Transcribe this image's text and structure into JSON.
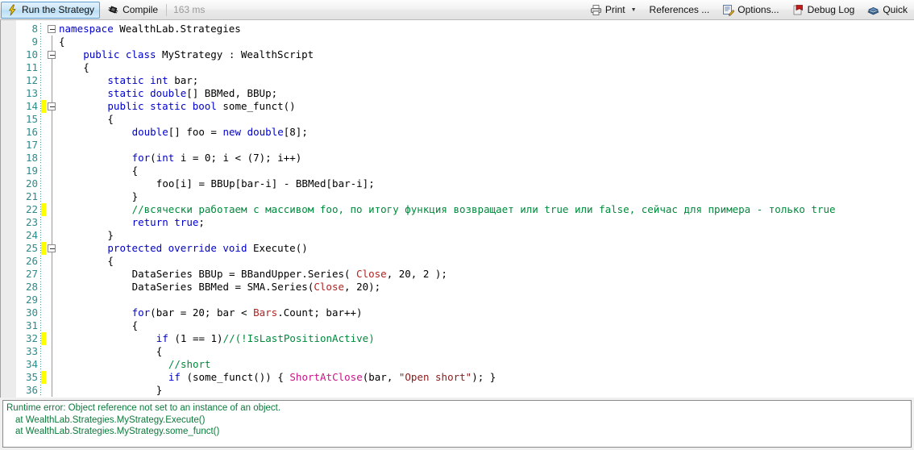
{
  "toolbar": {
    "run_label": "Run the Strategy",
    "compile_label": "Compile",
    "compile_time": "163 ms",
    "print_label": "Print",
    "references_label": "References ...",
    "options_label": "Options...",
    "debug_log_label": "Debug Log",
    "quick_label": "Quick",
    "icons": {
      "run": "lightning-bolt-icon",
      "compile": "chip-icon",
      "print": "printer-icon",
      "options": "pencil-note-icon",
      "debug": "bookmark-flag-icon",
      "quick": "book-icon"
    },
    "colors": {
      "active_button_border": "#5b9fd4",
      "active_button_fill": "#c9e6f8",
      "time_text": "#9a9a9a"
    }
  },
  "editor": {
    "first_line_number": 8,
    "gutter_color": "#2e8b8b",
    "modified_marker_color": "#ffff00",
    "syntax_colors": {
      "keyword": "#0000cd",
      "comment": "#008a3c",
      "type": "#b22222",
      "string": "#8b1a1a",
      "function": "#c71585",
      "plain": "#000000"
    },
    "lines": [
      {
        "n": 8,
        "marked": false,
        "fold": "open",
        "guide": false,
        "indent": 0,
        "tokens": [
          {
            "t": "namespace ",
            "c": "kw"
          },
          {
            "t": "WealthLab.Strategies",
            "c": "pl"
          }
        ]
      },
      {
        "n": 9,
        "marked": false,
        "fold": "none",
        "guide": true,
        "indent": 0,
        "tokens": [
          {
            "t": "{",
            "c": "pl"
          }
        ]
      },
      {
        "n": 10,
        "marked": false,
        "fold": "open",
        "guide": true,
        "indent": 2,
        "tokens": [
          {
            "t": "public class ",
            "c": "kw"
          },
          {
            "t": "MyStrategy : WealthScript",
            "c": "pl"
          }
        ]
      },
      {
        "n": 11,
        "marked": false,
        "fold": "none",
        "guide": true,
        "indent": 2,
        "tokens": [
          {
            "t": "{",
            "c": "pl"
          }
        ]
      },
      {
        "n": 12,
        "marked": false,
        "fold": "none",
        "guide": true,
        "indent": 4,
        "tokens": [
          {
            "t": "static int ",
            "c": "kw"
          },
          {
            "t": "bar;",
            "c": "pl"
          }
        ]
      },
      {
        "n": 13,
        "marked": false,
        "fold": "none",
        "guide": true,
        "indent": 4,
        "tokens": [
          {
            "t": "static double",
            "c": "kw"
          },
          {
            "t": "[] BBMed, BBUp;",
            "c": "pl"
          }
        ]
      },
      {
        "n": 14,
        "marked": true,
        "fold": "open",
        "guide": true,
        "indent": 4,
        "tokens": [
          {
            "t": "public static bool ",
            "c": "kw"
          },
          {
            "t": "some_funct()",
            "c": "pl"
          }
        ]
      },
      {
        "n": 15,
        "marked": false,
        "fold": "none",
        "guide": true,
        "indent": 4,
        "tokens": [
          {
            "t": "{",
            "c": "pl"
          }
        ]
      },
      {
        "n": 16,
        "marked": false,
        "fold": "none",
        "guide": true,
        "indent": 6,
        "tokens": [
          {
            "t": "double",
            "c": "kw"
          },
          {
            "t": "[] foo = ",
            "c": "pl"
          },
          {
            "t": "new double",
            "c": "kw"
          },
          {
            "t": "[8];",
            "c": "pl"
          }
        ]
      },
      {
        "n": 17,
        "marked": false,
        "fold": "none",
        "guide": true,
        "indent": 0,
        "tokens": []
      },
      {
        "n": 18,
        "marked": false,
        "fold": "none",
        "guide": true,
        "indent": 6,
        "tokens": [
          {
            "t": "for",
            "c": "kw"
          },
          {
            "t": "(",
            "c": "pl"
          },
          {
            "t": "int ",
            "c": "kw"
          },
          {
            "t": "i = 0; i < (7); i++)",
            "c": "pl"
          }
        ]
      },
      {
        "n": 19,
        "marked": false,
        "fold": "none",
        "guide": true,
        "indent": 6,
        "tokens": [
          {
            "t": "{",
            "c": "pl"
          }
        ]
      },
      {
        "n": 20,
        "marked": false,
        "fold": "none",
        "guide": true,
        "indent": 8,
        "tokens": [
          {
            "t": "foo[i] = BBUp[bar-i] - BBMed[bar-i];",
            "c": "pl"
          }
        ]
      },
      {
        "n": 21,
        "marked": false,
        "fold": "none",
        "guide": true,
        "indent": 6,
        "tokens": [
          {
            "t": "}",
            "c": "pl"
          }
        ]
      },
      {
        "n": 22,
        "marked": true,
        "fold": "none",
        "guide": true,
        "indent": 6,
        "tokens": [
          {
            "t": "//всячески работаем с массивом foo, по итогу функция возвращает или true или false, сейчас для примера - только true",
            "c": "cm"
          }
        ]
      },
      {
        "n": 23,
        "marked": false,
        "fold": "none",
        "guide": true,
        "indent": 6,
        "tokens": [
          {
            "t": "return true",
            "c": "kw"
          },
          {
            "t": ";",
            "c": "pl"
          }
        ]
      },
      {
        "n": 24,
        "marked": false,
        "fold": "none",
        "guide": true,
        "indent": 4,
        "tokens": [
          {
            "t": "}",
            "c": "pl"
          }
        ]
      },
      {
        "n": 25,
        "marked": true,
        "fold": "open",
        "guide": true,
        "indent": 4,
        "tokens": [
          {
            "t": "protected override void ",
            "c": "kw"
          },
          {
            "t": "Execute()",
            "c": "pl"
          }
        ]
      },
      {
        "n": 26,
        "marked": false,
        "fold": "none",
        "guide": true,
        "indent": 4,
        "tokens": [
          {
            "t": "{",
            "c": "pl"
          }
        ]
      },
      {
        "n": 27,
        "marked": false,
        "fold": "none",
        "guide": true,
        "indent": 6,
        "tokens": [
          {
            "t": "DataSeries BBUp = BBandUpper.Series( ",
            "c": "pl"
          },
          {
            "t": "Close",
            "c": "ty"
          },
          {
            "t": ", 20, 2 );",
            "c": "pl"
          }
        ]
      },
      {
        "n": 28,
        "marked": false,
        "fold": "none",
        "guide": true,
        "indent": 6,
        "tokens": [
          {
            "t": "DataSeries BBMed = SMA.Series(",
            "c": "pl"
          },
          {
            "t": "Close",
            "c": "ty"
          },
          {
            "t": ", 20);",
            "c": "pl"
          }
        ]
      },
      {
        "n": 29,
        "marked": false,
        "fold": "none",
        "guide": true,
        "indent": 0,
        "tokens": []
      },
      {
        "n": 30,
        "marked": false,
        "fold": "none",
        "guide": true,
        "indent": 6,
        "tokens": [
          {
            "t": "for",
            "c": "kw"
          },
          {
            "t": "(bar = 20; bar < ",
            "c": "pl"
          },
          {
            "t": "Bars",
            "c": "ty"
          },
          {
            "t": ".Count; bar++)",
            "c": "pl"
          }
        ]
      },
      {
        "n": 31,
        "marked": false,
        "fold": "none",
        "guide": true,
        "indent": 6,
        "tokens": [
          {
            "t": "{",
            "c": "pl"
          }
        ]
      },
      {
        "n": 32,
        "marked": true,
        "fold": "none",
        "guide": true,
        "indent": 8,
        "tokens": [
          {
            "t": "if ",
            "c": "kw"
          },
          {
            "t": "(1 == 1)",
            "c": "pl"
          },
          {
            "t": "//(!IsLastPositionActive)",
            "c": "cm"
          }
        ]
      },
      {
        "n": 33,
        "marked": false,
        "fold": "none",
        "guide": true,
        "indent": 8,
        "tokens": [
          {
            "t": "{",
            "c": "pl"
          }
        ]
      },
      {
        "n": 34,
        "marked": false,
        "fold": "none",
        "guide": true,
        "indent": 9,
        "tokens": [
          {
            "t": "//short",
            "c": "cm"
          }
        ]
      },
      {
        "n": 35,
        "marked": true,
        "fold": "none",
        "guide": true,
        "indent": 9,
        "tokens": [
          {
            "t": "if ",
            "c": "kw"
          },
          {
            "t": "(some_funct()) { ",
            "c": "pl"
          },
          {
            "t": "ShortAtClose",
            "c": "fn"
          },
          {
            "t": "(bar, ",
            "c": "pl"
          },
          {
            "t": "\"Open short\"",
            "c": "st"
          },
          {
            "t": "); }",
            "c": "pl"
          }
        ]
      },
      {
        "n": 36,
        "marked": false,
        "fold": "none",
        "guide": true,
        "indent": 8,
        "tokens": [
          {
            "t": "}",
            "c": "pl"
          }
        ]
      }
    ]
  },
  "error_panel": {
    "text_color": "#0a7a3a",
    "lines": [
      {
        "text": "Runtime error: Object reference not set to an instance of an object.",
        "indent": false
      },
      {
        "text": "at WealthLab.Strategies.MyStrategy.Execute()",
        "indent": true
      },
      {
        "text": "at WealthLab.Strategies.MyStrategy.some_funct()",
        "indent": true
      }
    ]
  }
}
